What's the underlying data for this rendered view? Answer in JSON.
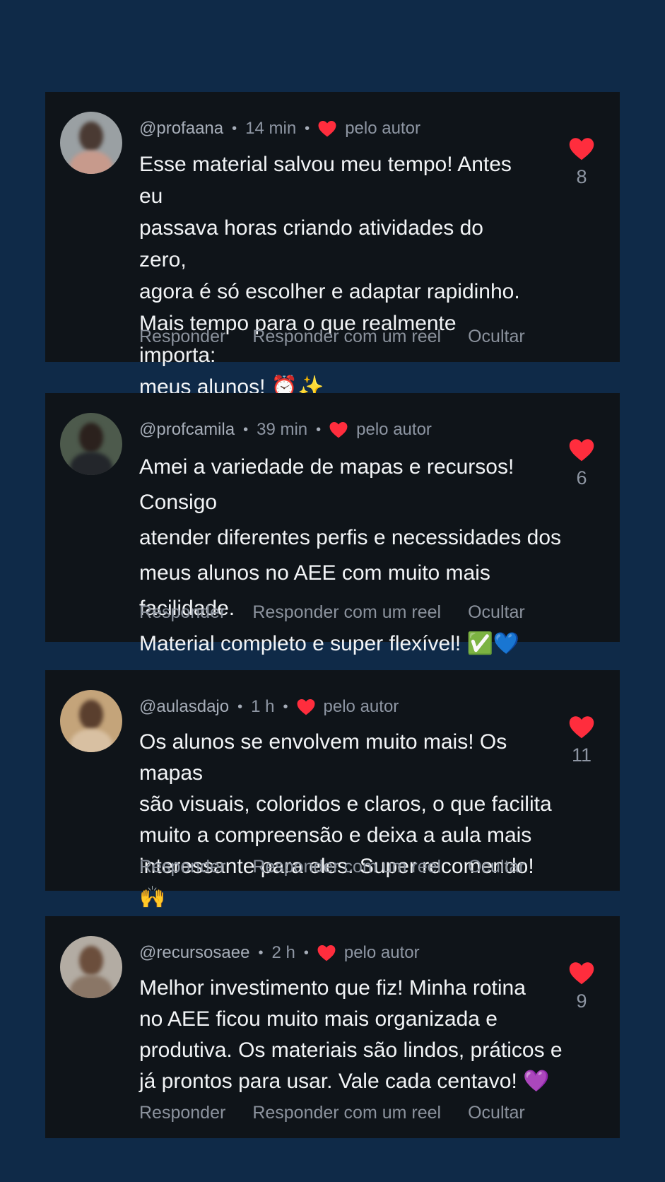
{
  "colors": {
    "background": "#0f2a48",
    "card": "#0f1419",
    "heart": "#ff2d3d",
    "text": "#f2f4f6",
    "muted": "#8e96a3"
  },
  "comments": [
    {
      "username": "@profaana",
      "time": "14 min",
      "liked_by_author": "pelo autor",
      "text": "Esse material salvou meu tempo! Antes eu\npassava horas criando atividades do zero,\nagora é só escolher e adaptar rapidinho.\nMais tempo para o que realmente importa:\nmeus alunos! ⏰✨",
      "likes": "8",
      "actions": [
        "Responder",
        "Responder com um reel",
        "Ocultar"
      ]
    },
    {
      "username": "@profcamila",
      "time": "39 min",
      "liked_by_author": "pelo autor",
      "text": "Amei a variedade de mapas e recursos! Consigo\natender diferentes perfis e necessidades dos\nmeus alunos no AEE com muito mais facilidade.\nMaterial completo e super flexível! ✅💙",
      "likes": "6",
      "actions": [
        "Responder",
        "Responder com um reel",
        "Ocultar"
      ]
    },
    {
      "username": "@aulasdajo",
      "time": "1 h",
      "liked_by_author": "pelo autor",
      "text": "Os alunos se envolvem muito mais! Os mapas\nsão visuais, coloridos e claros, o que facilita\nmuito a compreensão e deixa a aula mais\ninteressante para eles. Super recomendo! 🙌",
      "likes": "11",
      "actions": [
        "Responder",
        "Responder com um reel",
        "Ocultar"
      ]
    },
    {
      "username": "@recursosaee",
      "time": "2 h",
      "liked_by_author": "pelo autor",
      "text": "Melhor investimento que fiz! Minha rotina\nno AEE ficou muito mais organizada e\nprodutiva. Os materiais são lindos, práticos e\njá prontos para usar. Vale cada centavo! 💜",
      "likes": "9",
      "actions": [
        "Responder",
        "Responder com um reel",
        "Ocultar"
      ]
    }
  ]
}
